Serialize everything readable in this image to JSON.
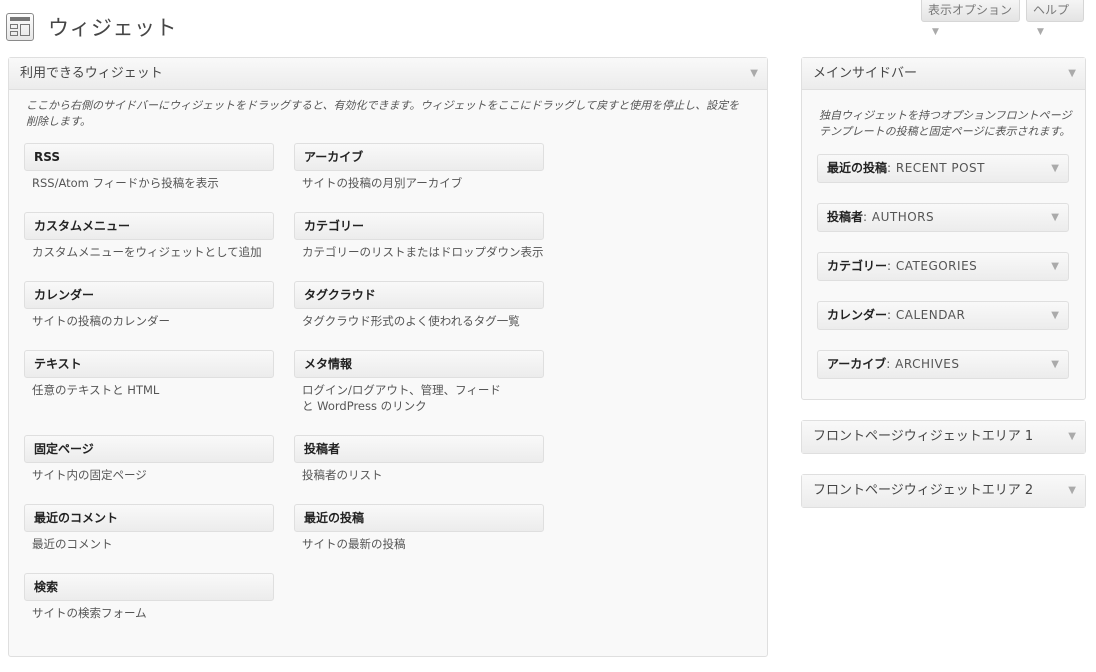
{
  "page": {
    "title": "ウィジェット",
    "screen_options": "表示オプション",
    "help": "ヘルプ",
    "arrow": "▼"
  },
  "available": {
    "title": "利用できるウィジェット",
    "description": "ここから右側のサイドバーにウィジェットをドラッグすると、有効化できます。ウィジェットをここにドラッグして戻すと使用を停止し、設定を削除します。",
    "widgets": [
      {
        "title": "RSS",
        "desc": "RSS/Atom フィードから投稿を表示"
      },
      {
        "title": "アーカイブ",
        "desc": "サイトの投稿の月別アーカイブ"
      },
      {
        "title": "カスタムメニュー",
        "desc": "カスタムメニューをウィジェットとして追加"
      },
      {
        "title": "カテゴリー",
        "desc": "カテゴリーのリストまたはドロップダウン表示"
      },
      {
        "title": "カレンダー",
        "desc": "サイトの投稿のカレンダー"
      },
      {
        "title": "タグクラウド",
        "desc": "タグクラウド形式のよく使われるタグ一覧"
      },
      {
        "title": "テキスト",
        "desc": "任意のテキストと HTML"
      },
      {
        "title": "メタ情報",
        "desc": "ログイン/ログアウト、管理、フィードと WordPress のリンク"
      },
      {
        "title": "固定ページ",
        "desc": "サイト内の固定ページ"
      },
      {
        "title": "投稿者",
        "desc": "投稿者のリスト"
      },
      {
        "title": "最近のコメント",
        "desc": "最近のコメント"
      },
      {
        "title": "最近の投稿",
        "desc": "サイトの最新の投稿"
      },
      {
        "title": "検索",
        "desc": "サイトの検索フォーム"
      }
    ]
  },
  "main_sidebar": {
    "title": "メインサイドバー",
    "description": "独自ウィジェットを持つオプションフロントページテンプレートの投稿と固定ページに表示されます。",
    "widgets": [
      {
        "name": "最近の投稿",
        "sub": ": RECENT POST"
      },
      {
        "name": "投稿者",
        "sub": ": AUTHORS"
      },
      {
        "name": "カテゴリー",
        "sub": ": CATEGORIES"
      },
      {
        "name": "カレンダー",
        "sub": ": CALENDAR"
      },
      {
        "name": "アーカイブ",
        "sub": ": ARCHIVES"
      }
    ]
  },
  "front_area_1": {
    "title": "フロントページウィジェットエリア 1"
  },
  "front_area_2": {
    "title": "フロントページウィジェットエリア 2"
  }
}
